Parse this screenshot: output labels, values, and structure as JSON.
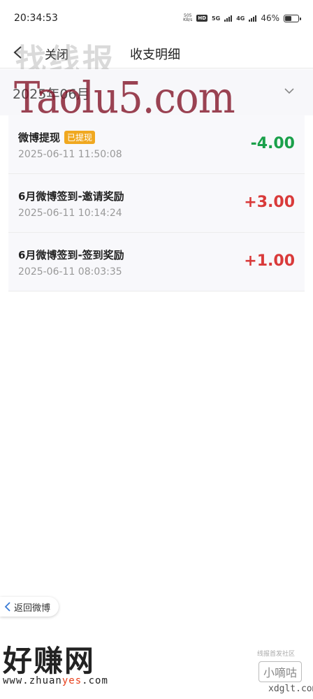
{
  "status_bar": {
    "time": "20:34:53",
    "speed_value": "505",
    "speed_unit": "KB/s",
    "hd_label": "HD",
    "net_5g": "5G",
    "net_4g": "4G",
    "battery_pct": "46%",
    "battery_level": 0.46
  },
  "nav": {
    "close_label": "关闭",
    "title": "收支明细"
  },
  "watermarks": {
    "top": "找线报",
    "mid": "Taolu5.com",
    "bottom_brand": "好赚网",
    "bottom_url_prefix": "www.zhuan",
    "bottom_url_highlight": "yes",
    "bottom_url_suffix": ".com",
    "corner_small": "线报首发社区",
    "corner_brand": "小嘀咕",
    "corner_url": "xdglt.com"
  },
  "month": {
    "label": "2025年06月"
  },
  "transactions": [
    {
      "title": "微博提现",
      "badge": "已提现",
      "time": "2025-06-11 11:50:08",
      "amount": "-4.00"
    },
    {
      "title": "6月微博签到-邀请奖励",
      "badge": "",
      "time": "2025-06-11 10:14:24",
      "amount": "+3.00"
    },
    {
      "title": "6月微博签到-签到奖励",
      "badge": "",
      "time": "2025-06-11 08:03:35",
      "amount": "+1.00"
    }
  ],
  "footer": {
    "back_label": "返回微博"
  },
  "colors": {
    "negative": "#1aa04a",
    "positive": "#d93a3a",
    "badge": "#f0a820"
  }
}
